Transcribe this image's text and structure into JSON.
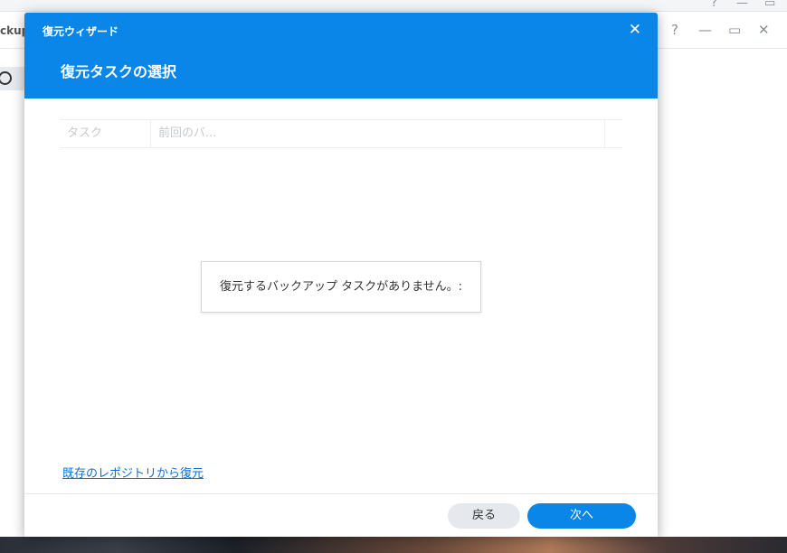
{
  "background_app": {
    "title_fragment": "ckup",
    "controls": {
      "help": "?",
      "minimize": "—",
      "maximize": "▭",
      "close": "✕"
    }
  },
  "dialog": {
    "wizard_title": "復元ウィザード",
    "heading": "復元タスクの選択",
    "close_symbol": "✕",
    "grid": {
      "columns": [
        "タスク",
        "前回のバ..."
      ]
    },
    "empty_message": "復元するバックアップ タスクがありません。:",
    "repository_link": "既存のレポジトリから復元",
    "buttons": {
      "back": "戻る",
      "next": "次へ"
    }
  },
  "colors": {
    "header_blue": "#0a86e8",
    "link_blue": "#0a6ed1",
    "button_gray": "#e5e9ee"
  }
}
